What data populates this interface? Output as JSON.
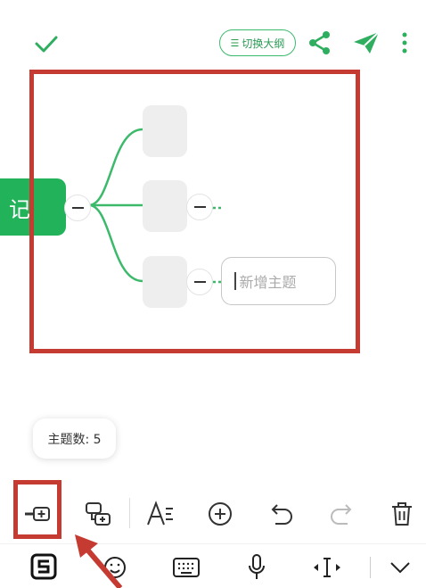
{
  "top_bar": {
    "outline_toggle_label": "切换大纲"
  },
  "mindmap": {
    "root_label": "记",
    "new_topic_placeholder": "新增主题"
  },
  "status": {
    "topic_count_label": "主题数: 5"
  },
  "colors": {
    "brand_green": "#21b25a",
    "annotation_red": "#c53a31"
  },
  "toolbar": {
    "icons": [
      "add-sibling-topic-icon",
      "add-child-topic-icon",
      "text-style-icon",
      "insert-icon",
      "undo-icon",
      "redo-icon",
      "delete-icon"
    ]
  },
  "keyboard_bar": {
    "icons": [
      "sogou-input-icon",
      "emoji-icon",
      "keyboard-icon",
      "microphone-icon",
      "cursor-move-icon",
      "collapse-keyboard-icon"
    ]
  }
}
